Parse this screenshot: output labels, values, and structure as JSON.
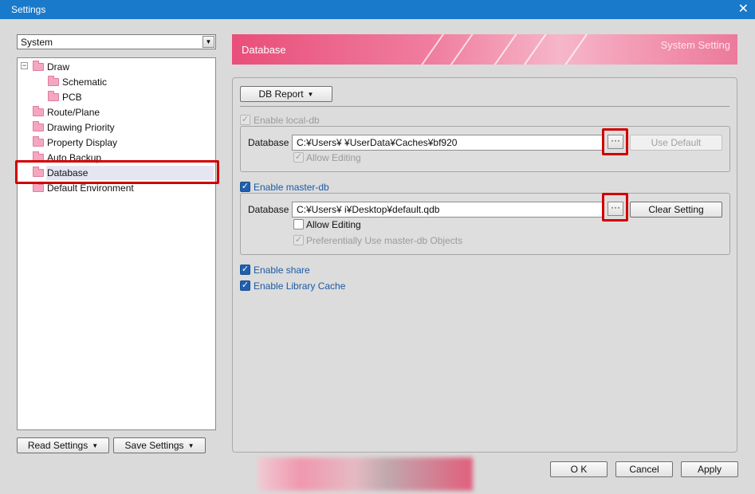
{
  "window": {
    "title": "Settings",
    "close_glyph": "✕"
  },
  "left": {
    "combo_value": "System",
    "tree": [
      {
        "label": "Draw",
        "expander": "−"
      },
      {
        "label": "Schematic"
      },
      {
        "label": "PCB"
      },
      {
        "label": "Route/Plane"
      },
      {
        "label": "Drawing Priority"
      },
      {
        "label": "Property Display"
      },
      {
        "label": "Auto Backup"
      },
      {
        "label": "Database"
      },
      {
        "label": "Default Environment"
      }
    ],
    "read_settings": "Read Settings",
    "save_settings": "Save Settings"
  },
  "banner": {
    "title": "Database",
    "right": "System Setting"
  },
  "main": {
    "db_report": "DB Report",
    "enable_local": "Enable local-db",
    "local_db_label": "Database",
    "local_db_path": "C:¥Users¥                                                        ¥UserData¥Caches¥bf920",
    "local_allow_editing": "Allow Editing",
    "use_default": "Use Default",
    "enable_master": "Enable master-db",
    "master_db_label": "Database",
    "master_db_path": "C:¥Users¥               i¥Desktop¥default.qdb",
    "master_allow_editing": "Allow Editing",
    "pref_master": "Preferentially Use master-db Objects",
    "clear_setting": "Clear Setting",
    "enable_share": "Enable share",
    "enable_library_cache": "Enable Library Cache",
    "browse_glyph": "···"
  },
  "footer": {
    "ok": "O K",
    "cancel": "Cancel",
    "apply": "Apply"
  },
  "colors": {
    "accent": "#1979ca",
    "highlight_red": "#d10000",
    "banner_pink": "#ef7c9f"
  }
}
